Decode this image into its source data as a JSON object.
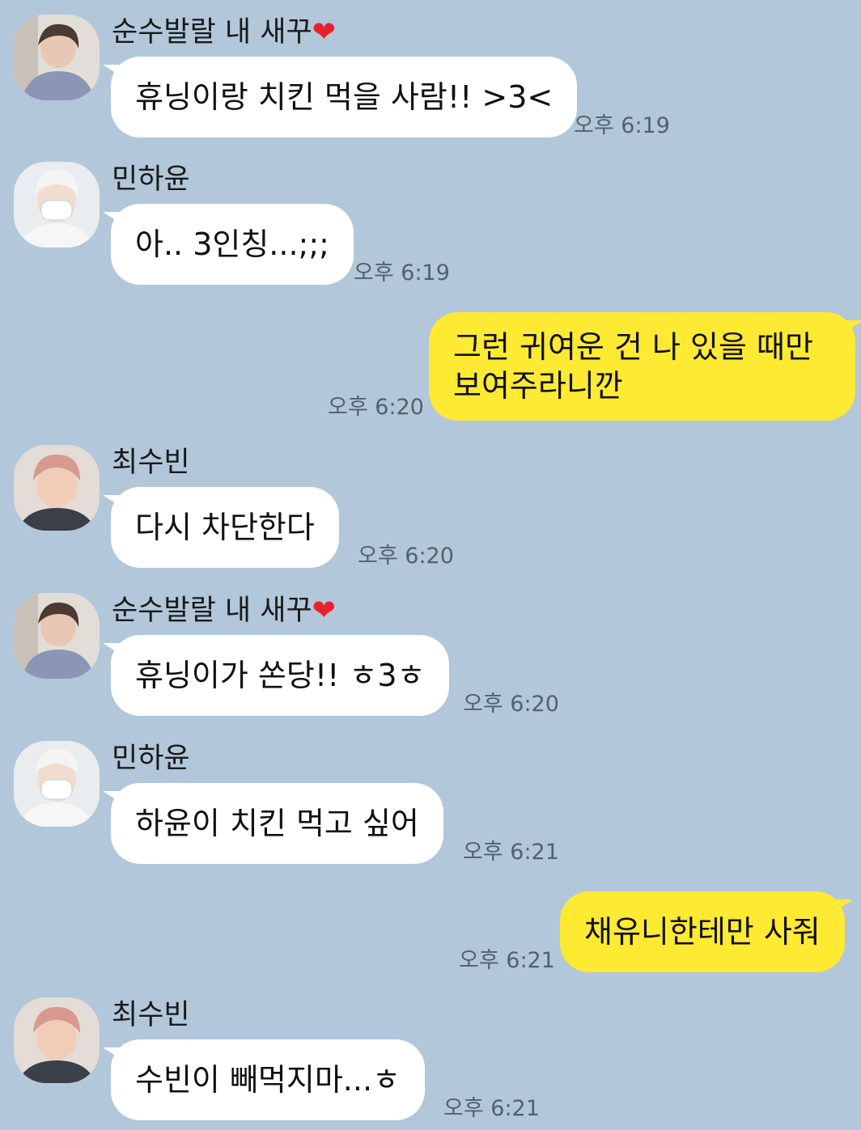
{
  "chat": {
    "messages": [
      {
        "sender": "순수발랄 내 새꾸",
        "heart": "❤",
        "text": "휴닝이랑 치킨 먹을 사람!! >3<",
        "time": "오후 6:19"
      },
      {
        "sender": "민하윤",
        "text": "아.. 3인칭...;;;",
        "time": "오후 6:19"
      },
      {
        "sender": "me",
        "line1": "그런 귀여운 건 나 있을 때만",
        "line2": "보여주라니깐",
        "time": "오후 6:20"
      },
      {
        "sender": "최수빈",
        "text": "다시 차단한다",
        "time": "오후 6:20"
      },
      {
        "sender": "순수발랄 내 새꾸",
        "heart": "❤",
        "text": "휴닝이가 쏜당!! ㅎ3ㅎ",
        "time": "오후 6:20"
      },
      {
        "sender": "민하윤",
        "text": "하윤이 치킨 먹고 싶어",
        "time": "오후 6:21"
      },
      {
        "sender": "me",
        "text": "채유니한테만 사줘",
        "time": "오후 6:21"
      },
      {
        "sender": "최수빈",
        "text": "수빈이 빼먹지마...ㅎ",
        "time": "오후 6:21"
      }
    ]
  },
  "colors": {
    "background": "#b2c7da",
    "incoming_bubble": "#ffffff",
    "outgoing_bubble": "#fee933",
    "timestamp": "#55606b"
  },
  "avatars": {
    "hueningkai": "avatar-photo-grey-sweater",
    "hayoon": "avatar-photo-white-mask",
    "soobin": "avatar-photo-pink-hair"
  }
}
